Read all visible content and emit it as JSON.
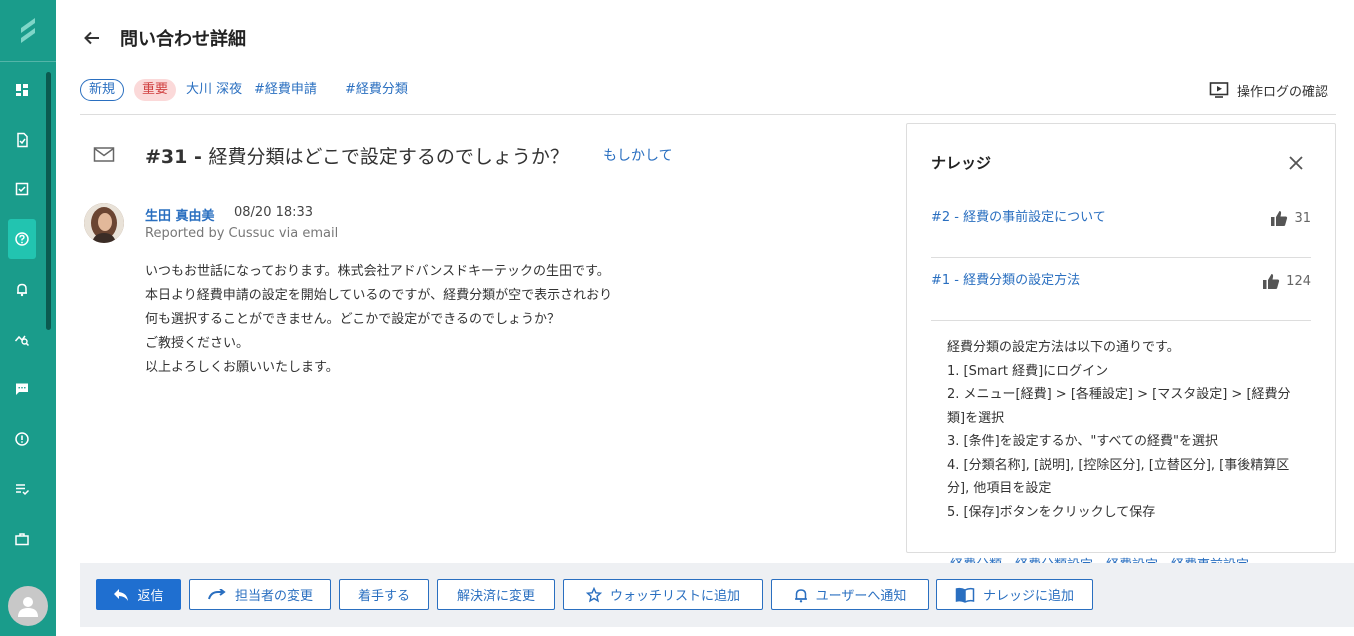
{
  "header": {
    "title": "問い合わせ詳細"
  },
  "tags": {
    "status": "新規",
    "priority": "重要",
    "assignee": "大川 深夜",
    "tag1": "#経費申請",
    "tag2": "#経費分類",
    "oplog_label": "操作ログの確認"
  },
  "ticket": {
    "number": "#31",
    "separator": " - ",
    "subject": "経費分類はどこで設定するのでしょうか？",
    "maybe_link": "もしかして"
  },
  "message": {
    "author": "生田 真由美",
    "time": "08/20 18:33",
    "reported": "Reported by Cussuc via email",
    "lines": [
      "いつもお世話になっております。株式会社アドバンスドキーテックの生田です。",
      "本日より経費申請の設定を開始しているのですが、経費分類が空で表示されおり",
      "何も選択することができません。どこかで設定ができるのでしょうか？",
      "ご教授ください。",
      "以上よろしくお願いいたします。"
    ]
  },
  "knowledge": {
    "title": "ナレッジ",
    "items": [
      {
        "title": "#2 - 経費の事前設定について",
        "likes": "31"
      },
      {
        "title": "#1 - 経費分類の設定方法",
        "likes": "124"
      }
    ],
    "body": [
      "経費分類の設定方法は以下の通りです。",
      "1. [Smart 経費]にログイン",
      "2. メニュー[経費] > [各種設定] > [マスタ設定] > [経費分",
      "類]を選択",
      "3. [条件]を設定するか、\"すべての経費\"を選択",
      "4. [分類名称], [説明], [控除区分], [立替区分], [事後精算区",
      "分], 他項目を設定",
      "5. [保存]ボタンをクリックして保存"
    ],
    "overflow_text": "経費分類、経費分類設定、経費設定、経費事前設定"
  },
  "actions": {
    "reply": "返信",
    "change_assignee": "担当者の変更",
    "start": "着手する",
    "resolve": "解決済に変更",
    "watchlist": "ウォッチリストに追加",
    "notify": "ユーザーへ通知",
    "add_knowledge": "ナレッジに追加"
  },
  "colors": {
    "sidebar": "#1a9c8b",
    "sidebar_active": "#22c4b0",
    "link": "#2a6fc0",
    "primary": "#1f6fd0",
    "priority_bg": "#fbd9d9",
    "priority_text": "#d04040"
  },
  "sidebar": {
    "icons": [
      "dashboard-icon",
      "document-check-icon",
      "checkbox-icon",
      "help-icon",
      "bell-icon",
      "analytics-icon",
      "chat-icon",
      "alert-icon",
      "checklist-icon",
      "briefcase-icon"
    ],
    "active": "help-icon"
  }
}
